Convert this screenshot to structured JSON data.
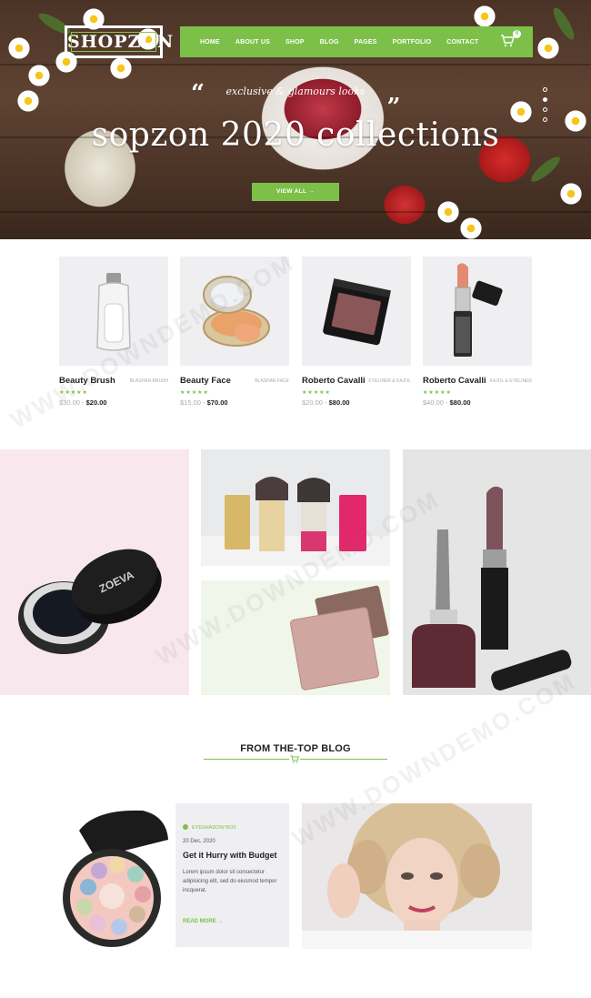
{
  "header": {
    "logo": "SHOPZON",
    "nav": [
      "HOME",
      "ABOUT US",
      "SHOP",
      "BLOG",
      "PAGES",
      "PORTFOLIO",
      "CONTACT"
    ],
    "cart_count": "0"
  },
  "hero": {
    "quote_open": "“",
    "quote_close": "„",
    "tagline": "exclusive & glamours looks",
    "title": "sopzon 2020 collections",
    "button": "VIEW ALL →"
  },
  "products": [
    {
      "name": "Beauty Brush",
      "category": "BLASHAN BRUSH",
      "stars": "★★★★★",
      "old_price": "$30.00",
      "sep": " - ",
      "new_price": "$20.00"
    },
    {
      "name": "Beauty Face",
      "category": "BLASHAN FACE",
      "stars": "★★★★★",
      "old_price": "$15.00",
      "sep": " - ",
      "new_price": "$70.00"
    },
    {
      "name": "Roberto Cavalli",
      "category": "EYELINER & KAJOL",
      "stars": "★★★★★",
      "old_price": "$20.00",
      "sep": " - ",
      "new_price": "$80.00"
    },
    {
      "name": "Roberto Cavalli",
      "category": "KAJOL & EYELINER",
      "stars": "★★★★★",
      "old_price": "$40.00",
      "sep": " - ",
      "new_price": "$80.00"
    }
  ],
  "banners": {
    "jar_brand": "ZOEVA"
  },
  "blog": {
    "section_title": "FROM THE-TOP BLOG",
    "section_icon": "cart-icon",
    "post": {
      "tag": "EYESHADOW BOX",
      "date": "20 Dec, 2020",
      "title": "Get it Hurry with Budget",
      "excerpt": "Lorem ipsum dolor sit consectetur adipisicing elit, sed do eiusmod tempor incquerat.",
      "read_more": "READ MORE →"
    }
  },
  "watermark": "WWW.DOWNDEMO.COM",
  "colors": {
    "accent": "#7cc04a",
    "tile_bg": "#efeef1",
    "pink_panel": "#f8e8ee",
    "mint_panel": "#f0f6ea"
  }
}
